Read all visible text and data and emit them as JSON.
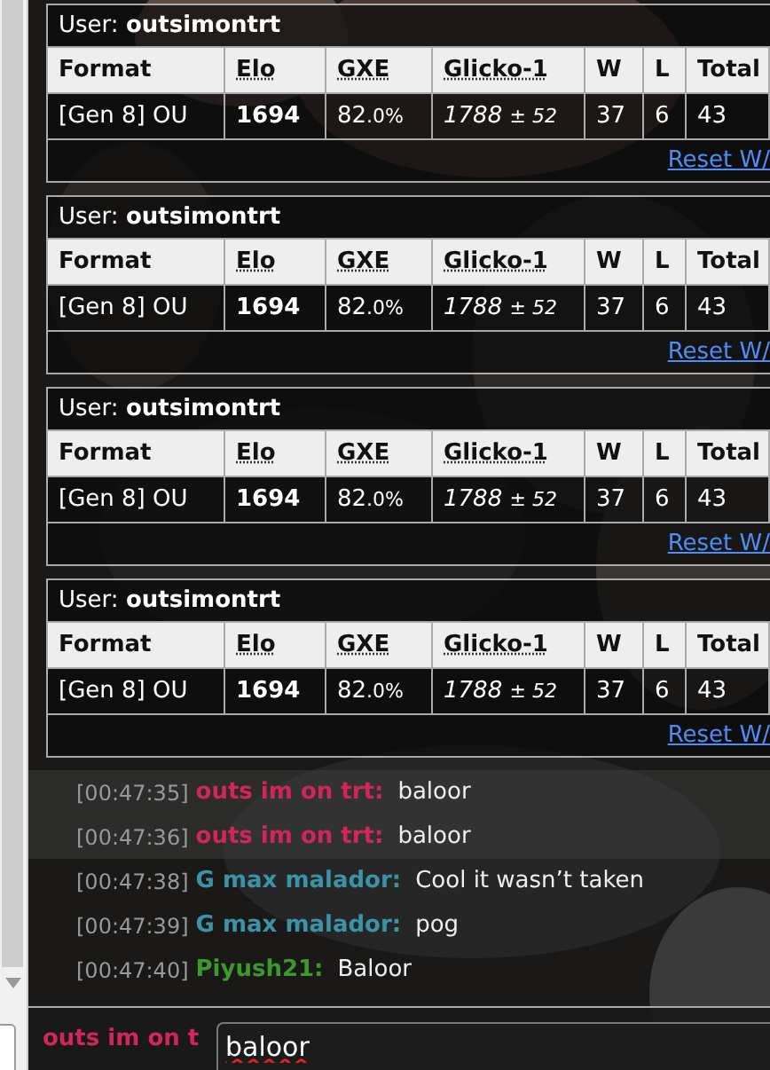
{
  "rank_cards": [
    {
      "user_label": "User:",
      "username": "outsimontrt",
      "columns": [
        "Format",
        "Elo",
        "GXE",
        "Glicko-1",
        "W",
        "L",
        "Total"
      ],
      "row": {
        "format": "[Gen 8] OU",
        "elo": "1694",
        "gxe": "82",
        "gxe_decimal": ".0%",
        "glicko": "1788",
        "glicko_dev": "± 52",
        "w": "37",
        "l": "6",
        "total": "43"
      },
      "reset_link": "Reset W/"
    },
    {
      "user_label": "User:",
      "username": "outsimontrt",
      "columns": [
        "Format",
        "Elo",
        "GXE",
        "Glicko-1",
        "W",
        "L",
        "Total"
      ],
      "row": {
        "format": "[Gen 8] OU",
        "elo": "1694",
        "gxe": "82",
        "gxe_decimal": ".0%",
        "glicko": "1788",
        "glicko_dev": "± 52",
        "w": "37",
        "l": "6",
        "total": "43"
      },
      "reset_link": "Reset W/"
    },
    {
      "user_label": "User:",
      "username": "outsimontrt",
      "columns": [
        "Format",
        "Elo",
        "GXE",
        "Glicko-1",
        "W",
        "L",
        "Total"
      ],
      "row": {
        "format": "[Gen 8] OU",
        "elo": "1694",
        "gxe": "82",
        "gxe_decimal": ".0%",
        "glicko": "1788",
        "glicko_dev": "± 52",
        "w": "37",
        "l": "6",
        "total": "43"
      },
      "reset_link": "Reset W/"
    },
    {
      "user_label": "User:",
      "username": "outsimontrt",
      "columns": [
        "Format",
        "Elo",
        "GXE",
        "Glicko-1",
        "W",
        "L",
        "Total"
      ],
      "row": {
        "format": "[Gen 8] OU",
        "elo": "1694",
        "gxe": "82",
        "gxe_decimal": ".0%",
        "glicko": "1788",
        "glicko_dev": "± 52",
        "w": "37",
        "l": "6",
        "total": "43"
      },
      "reset_link": "Reset W/"
    }
  ],
  "chat": [
    {
      "time": "[00:47:35]",
      "name": "outs im on trt:",
      "color": "#d1265a",
      "message": "baloor",
      "highlighted": true
    },
    {
      "time": "[00:47:36]",
      "name": "outs im on trt:",
      "color": "#d1265a",
      "message": "baloor",
      "highlighted": true
    },
    {
      "time": "[00:47:38]",
      "name": "G max malador:",
      "color": "#3a93a6",
      "message": "Cool it wasn’t taken",
      "highlighted": false
    },
    {
      "time": "[00:47:39]",
      "name": "G max malador:",
      "color": "#3a93a6",
      "message": "pog",
      "highlighted": false
    },
    {
      "time": "[00:47:40]",
      "name": "Piyush21:",
      "color": "#3a9a2a",
      "message": "Baloor",
      "highlighted": false
    }
  ],
  "composer": {
    "name": "outs im on t",
    "value": "baloor"
  }
}
